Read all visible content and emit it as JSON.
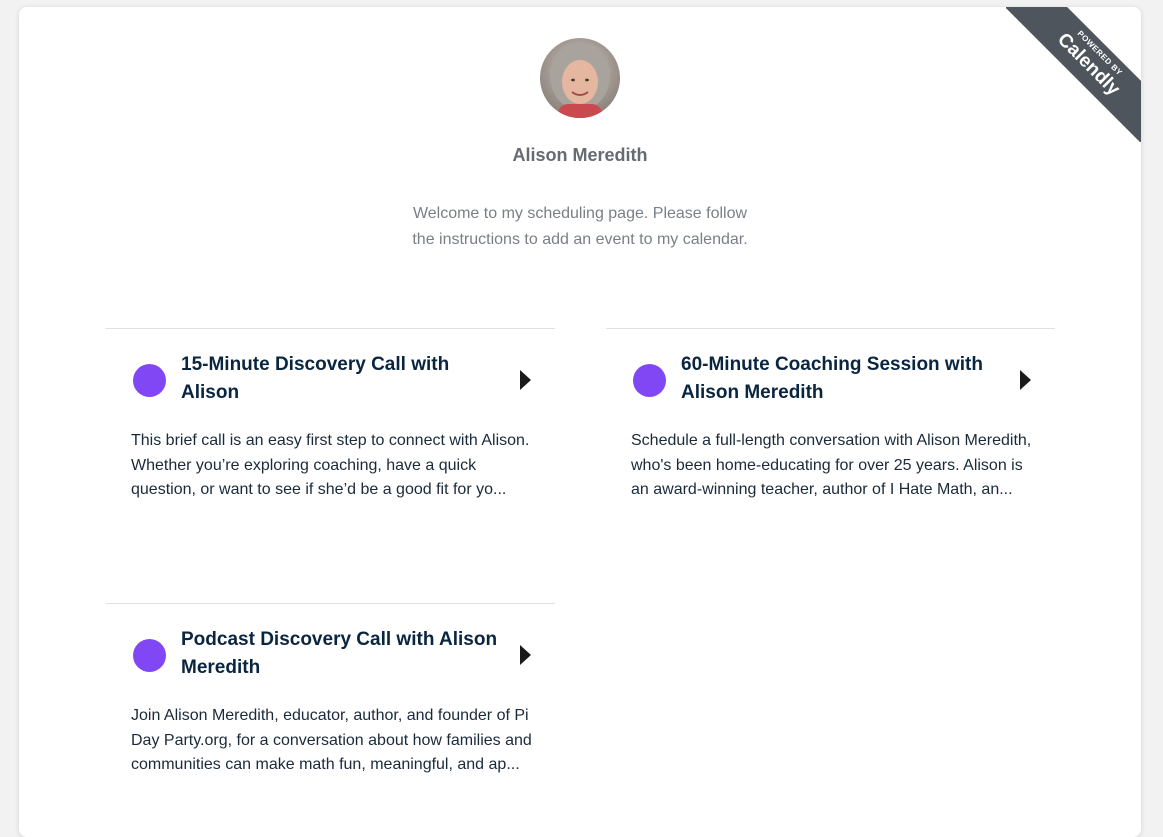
{
  "badge": {
    "powered_by": "POWERED BY",
    "brand": "Calendly",
    "color": "#4e555c"
  },
  "host": {
    "name": "Alison Meredith",
    "welcome": "Welcome to my scheduling page. Please follow the instructions to add an event to my calendar."
  },
  "accent_color": "#8247f5",
  "events": [
    {
      "title": "15-Minute Discovery Call with Alison",
      "description": "This brief call is an easy first step to connect with Alison. Whether you’re exploring coaching, have a quick question, or want to see if she’d be a good fit for yo..."
    },
    {
      "title": "60-Minute Coaching Session with Alison Meredith",
      "description": "Schedule a full-length conversation with Alison Meredith, who's been home-educating for over 25 years. Alison is an award-winning teacher, author of I Hate Math, an..."
    },
    {
      "title": "Podcast Discovery Call with Alison Meredith",
      "description": "Join Alison Meredith, educator, author, and founder of Pi Day Party.org, for a conversation about how families and communities can make math fun, meaningful, and ap..."
    }
  ]
}
